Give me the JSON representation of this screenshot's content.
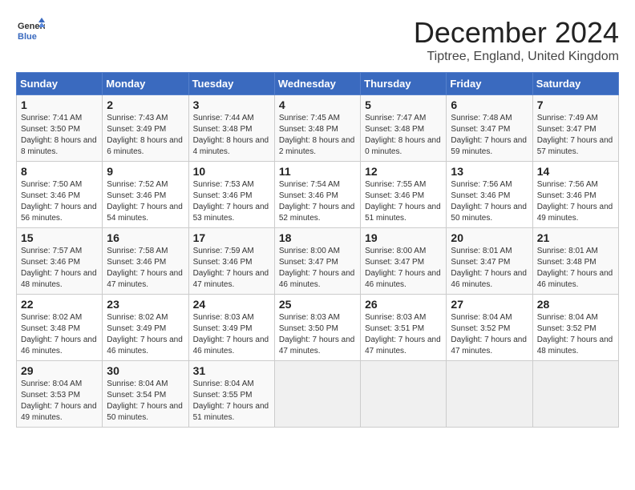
{
  "header": {
    "logo_line1": "General",
    "logo_line2": "Blue",
    "month": "December 2024",
    "location": "Tiptree, England, United Kingdom"
  },
  "days_of_week": [
    "Sunday",
    "Monday",
    "Tuesday",
    "Wednesday",
    "Thursday",
    "Friday",
    "Saturday"
  ],
  "weeks": [
    [
      {
        "day": "1",
        "sunrise": "7:41 AM",
        "sunset": "3:50 PM",
        "daylight": "8 hours and 8 minutes."
      },
      {
        "day": "2",
        "sunrise": "7:43 AM",
        "sunset": "3:49 PM",
        "daylight": "8 hours and 6 minutes."
      },
      {
        "day": "3",
        "sunrise": "7:44 AM",
        "sunset": "3:48 PM",
        "daylight": "8 hours and 4 minutes."
      },
      {
        "day": "4",
        "sunrise": "7:45 AM",
        "sunset": "3:48 PM",
        "daylight": "8 hours and 2 minutes."
      },
      {
        "day": "5",
        "sunrise": "7:47 AM",
        "sunset": "3:48 PM",
        "daylight": "8 hours and 0 minutes."
      },
      {
        "day": "6",
        "sunrise": "7:48 AM",
        "sunset": "3:47 PM",
        "daylight": "7 hours and 59 minutes."
      },
      {
        "day": "7",
        "sunrise": "7:49 AM",
        "sunset": "3:47 PM",
        "daylight": "7 hours and 57 minutes."
      }
    ],
    [
      {
        "day": "8",
        "sunrise": "7:50 AM",
        "sunset": "3:46 PM",
        "daylight": "7 hours and 56 minutes."
      },
      {
        "day": "9",
        "sunrise": "7:52 AM",
        "sunset": "3:46 PM",
        "daylight": "7 hours and 54 minutes."
      },
      {
        "day": "10",
        "sunrise": "7:53 AM",
        "sunset": "3:46 PM",
        "daylight": "7 hours and 53 minutes."
      },
      {
        "day": "11",
        "sunrise": "7:54 AM",
        "sunset": "3:46 PM",
        "daylight": "7 hours and 52 minutes."
      },
      {
        "day": "12",
        "sunrise": "7:55 AM",
        "sunset": "3:46 PM",
        "daylight": "7 hours and 51 minutes."
      },
      {
        "day": "13",
        "sunrise": "7:56 AM",
        "sunset": "3:46 PM",
        "daylight": "7 hours and 50 minutes."
      },
      {
        "day": "14",
        "sunrise": "7:56 AM",
        "sunset": "3:46 PM",
        "daylight": "7 hours and 49 minutes."
      }
    ],
    [
      {
        "day": "15",
        "sunrise": "7:57 AM",
        "sunset": "3:46 PM",
        "daylight": "7 hours and 48 minutes."
      },
      {
        "day": "16",
        "sunrise": "7:58 AM",
        "sunset": "3:46 PM",
        "daylight": "7 hours and 47 minutes."
      },
      {
        "day": "17",
        "sunrise": "7:59 AM",
        "sunset": "3:46 PM",
        "daylight": "7 hours and 47 minutes."
      },
      {
        "day": "18",
        "sunrise": "8:00 AM",
        "sunset": "3:47 PM",
        "daylight": "7 hours and 46 minutes."
      },
      {
        "day": "19",
        "sunrise": "8:00 AM",
        "sunset": "3:47 PM",
        "daylight": "7 hours and 46 minutes."
      },
      {
        "day": "20",
        "sunrise": "8:01 AM",
        "sunset": "3:47 PM",
        "daylight": "7 hours and 46 minutes."
      },
      {
        "day": "21",
        "sunrise": "8:01 AM",
        "sunset": "3:48 PM",
        "daylight": "7 hours and 46 minutes."
      }
    ],
    [
      {
        "day": "22",
        "sunrise": "8:02 AM",
        "sunset": "3:48 PM",
        "daylight": "7 hours and 46 minutes."
      },
      {
        "day": "23",
        "sunrise": "8:02 AM",
        "sunset": "3:49 PM",
        "daylight": "7 hours and 46 minutes."
      },
      {
        "day": "24",
        "sunrise": "8:03 AM",
        "sunset": "3:49 PM",
        "daylight": "7 hours and 46 minutes."
      },
      {
        "day": "25",
        "sunrise": "8:03 AM",
        "sunset": "3:50 PM",
        "daylight": "7 hours and 47 minutes."
      },
      {
        "day": "26",
        "sunrise": "8:03 AM",
        "sunset": "3:51 PM",
        "daylight": "7 hours and 47 minutes."
      },
      {
        "day": "27",
        "sunrise": "8:04 AM",
        "sunset": "3:52 PM",
        "daylight": "7 hours and 47 minutes."
      },
      {
        "day": "28",
        "sunrise": "8:04 AM",
        "sunset": "3:52 PM",
        "daylight": "7 hours and 48 minutes."
      }
    ],
    [
      {
        "day": "29",
        "sunrise": "8:04 AM",
        "sunset": "3:53 PM",
        "daylight": "7 hours and 49 minutes."
      },
      {
        "day": "30",
        "sunrise": "8:04 AM",
        "sunset": "3:54 PM",
        "daylight": "7 hours and 50 minutes."
      },
      {
        "day": "31",
        "sunrise": "8:04 AM",
        "sunset": "3:55 PM",
        "daylight": "7 hours and 51 minutes."
      },
      null,
      null,
      null,
      null
    ]
  ]
}
